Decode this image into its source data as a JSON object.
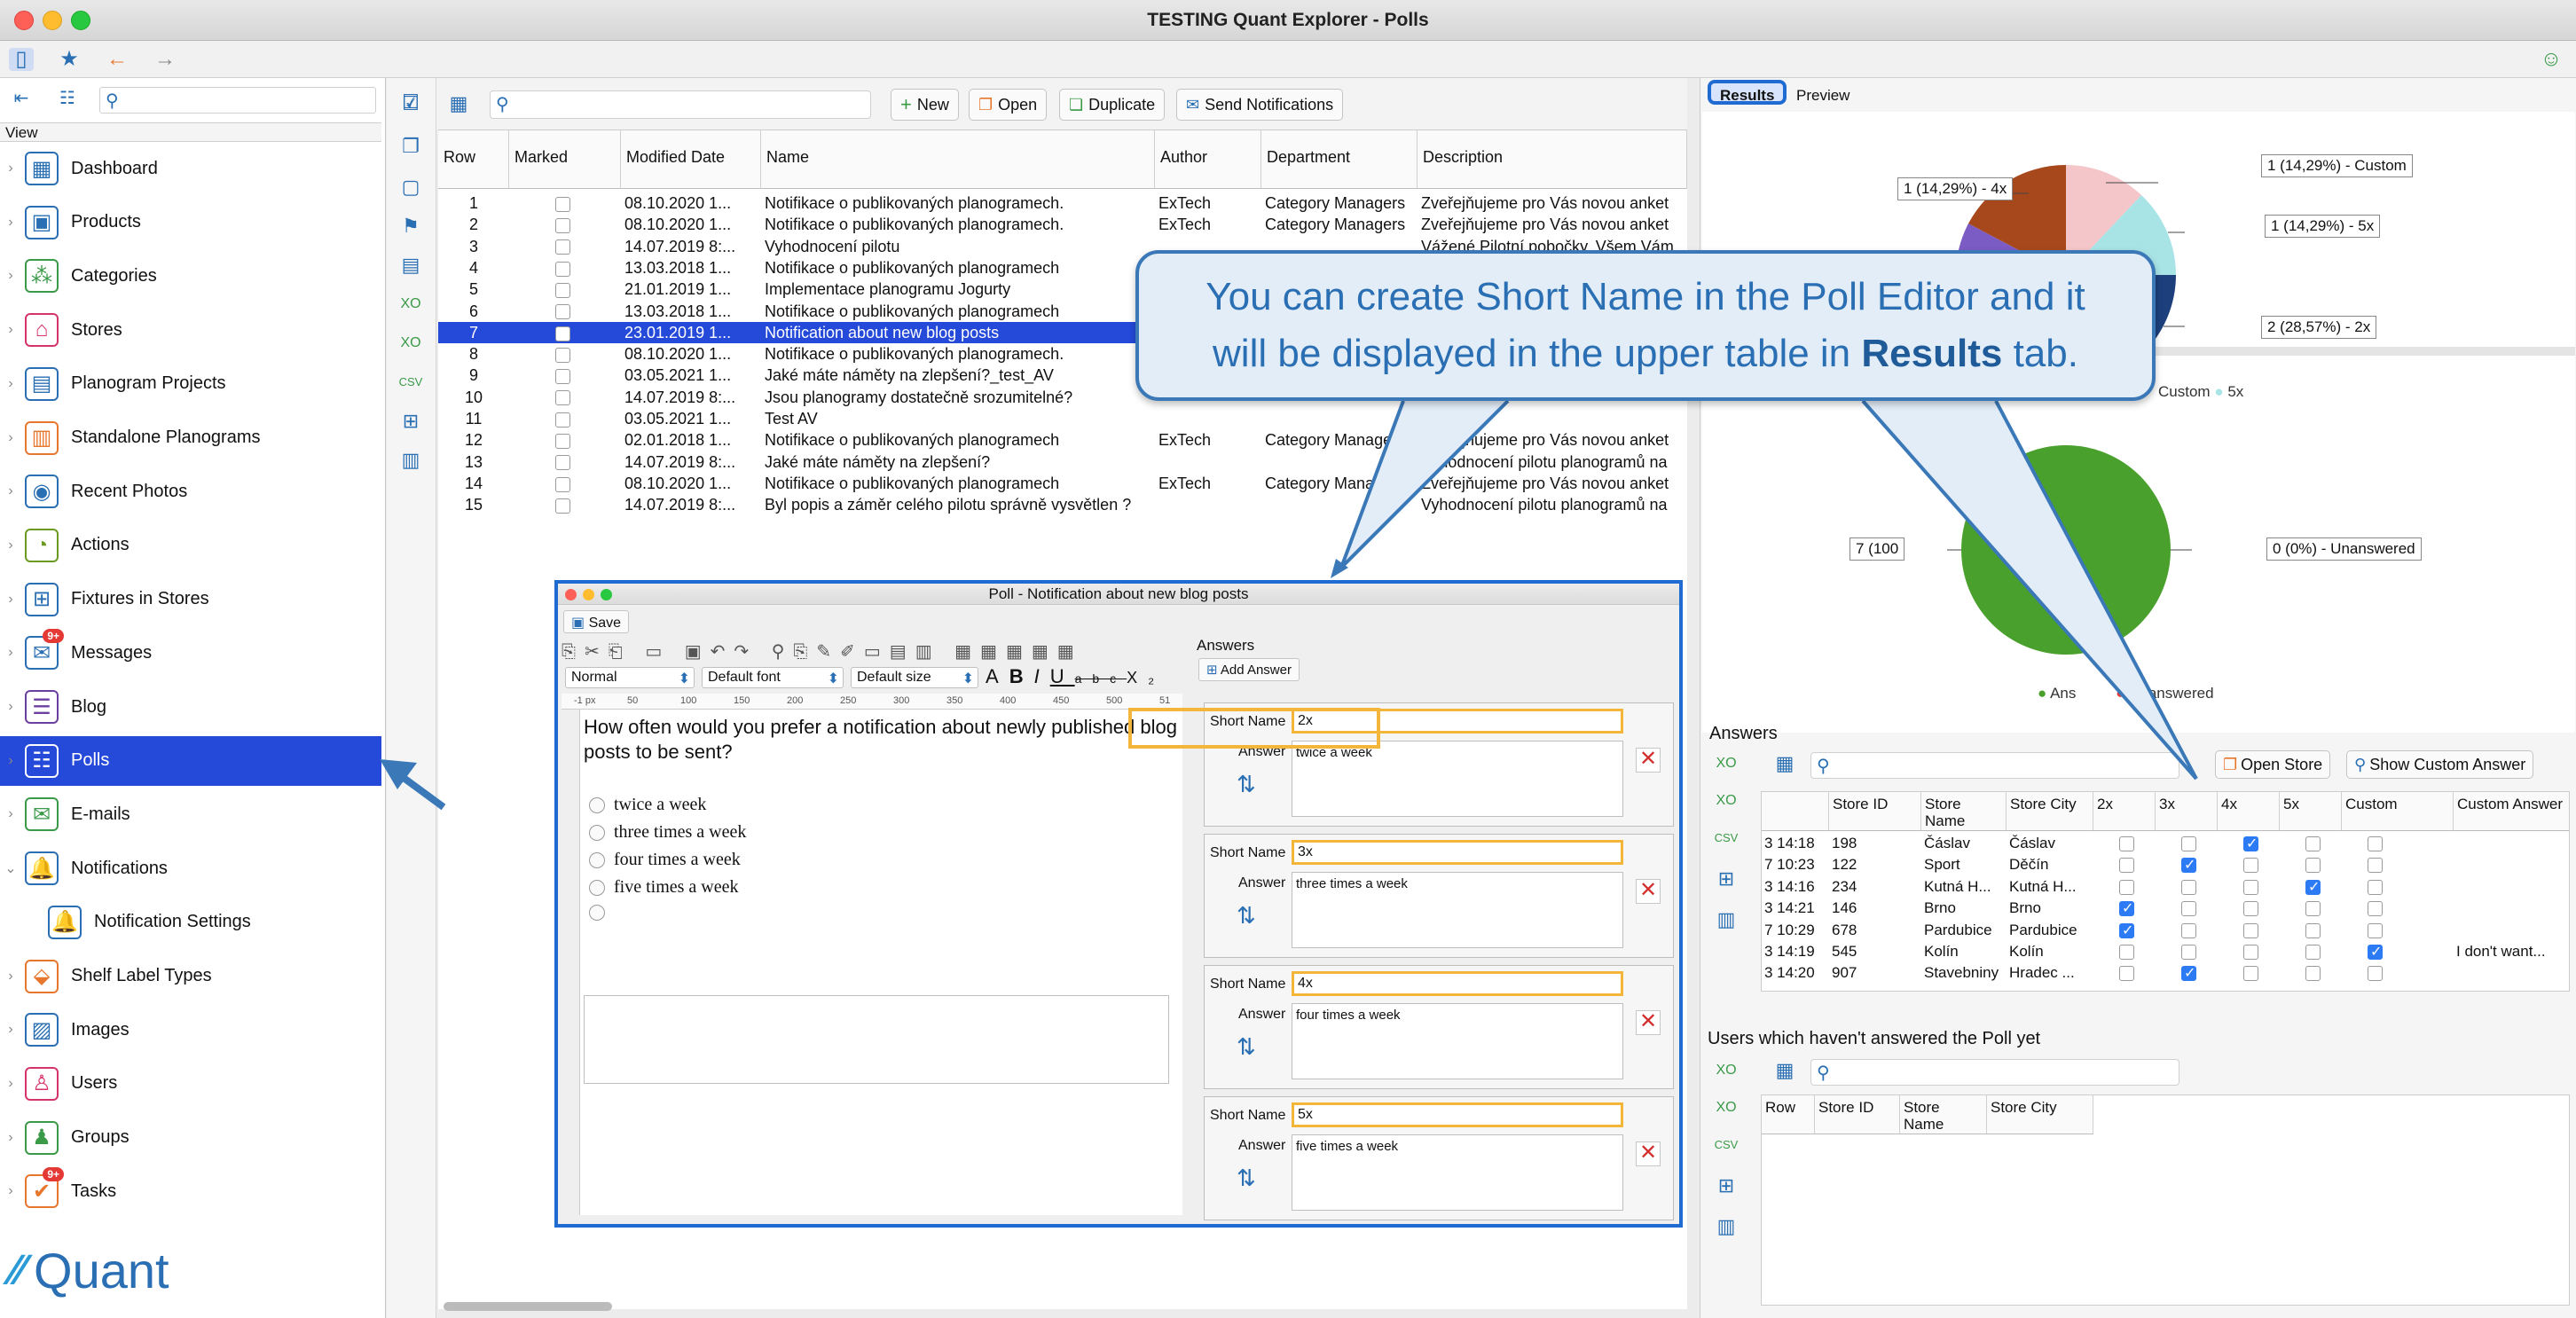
{
  "window": {
    "title": "TESTING Quant Explorer - Polls"
  },
  "sidebar": {
    "view_label": "View",
    "items": [
      {
        "label": "Dashboard",
        "icon": "dashboard-icon",
        "glyph": "▦",
        "color": "#2a6fb3"
      },
      {
        "label": "Products",
        "icon": "products-icon",
        "glyph": "▣",
        "color": "#2a6fb3"
      },
      {
        "label": "Categories",
        "icon": "categories-icon",
        "glyph": "⁂",
        "color": "#3a9a48"
      },
      {
        "label": "Stores",
        "icon": "stores-icon",
        "glyph": "⌂",
        "color": "#d6336c"
      },
      {
        "label": "Planogram Projects",
        "icon": "planogram-projects-icon",
        "glyph": "▤",
        "color": "#2a6fb3"
      },
      {
        "label": "Standalone Planograms",
        "icon": "standalone-planograms-icon",
        "glyph": "▥",
        "color": "#e8772e"
      },
      {
        "label": "Recent Photos",
        "icon": "camera-icon",
        "glyph": "◉",
        "color": "#2a6fb3"
      },
      {
        "label": "Actions",
        "icon": "actions-icon",
        "glyph": "◔",
        "color": "#6a9a20"
      },
      {
        "label": "Fixtures in Stores",
        "icon": "fixtures-icon",
        "glyph": "⊞",
        "color": "#2a6fb3"
      },
      {
        "label": "Messages",
        "icon": "messages-icon",
        "glyph": "✉",
        "color": "#2a6fb3",
        "badge": "9+"
      },
      {
        "label": "Blog",
        "icon": "blog-icon",
        "glyph": "☰",
        "color": "#6b3fa0"
      },
      {
        "label": "Polls",
        "icon": "polls-icon",
        "glyph": "☷",
        "color": "#d6336c"
      },
      {
        "label": "E-mails",
        "icon": "email-icon",
        "glyph": "✉",
        "color": "#3a9a48"
      },
      {
        "label": "Notifications",
        "icon": "notifications-icon",
        "glyph": "🔔",
        "color": "#2a6fb3"
      },
      {
        "label": "Notification Settings",
        "icon": "notification-settings-icon",
        "glyph": "🔔",
        "color": "#2a6fb3"
      },
      {
        "label": "Shelf Label Types",
        "icon": "shelf-label-icon",
        "glyph": "⬙",
        "color": "#e8772e"
      },
      {
        "label": "Images",
        "icon": "images-icon",
        "glyph": "▨",
        "color": "#2a6fb3"
      },
      {
        "label": "Users",
        "icon": "users-icon",
        "glyph": "♙",
        "color": "#d6336c"
      },
      {
        "label": "Groups",
        "icon": "groups-icon",
        "glyph": "♟",
        "color": "#3a9a48"
      },
      {
        "label": "Tasks",
        "icon": "tasks-icon",
        "glyph": "✔",
        "color": "#e8772e",
        "badge": "9+"
      }
    ],
    "logo_text": "Quant"
  },
  "toolbar": {
    "new_label": "New",
    "open_label": "Open",
    "duplicate_label": "Duplicate",
    "send_label": "Send Notifications"
  },
  "polls_table": {
    "columns": [
      "Row",
      "Marked",
      "Modified Date",
      "Name",
      "Author",
      "Department",
      "Description"
    ],
    "rows": [
      [
        "1",
        "",
        "08.10.2020 1...",
        "Notifikace o publikovaných planogramech.",
        "ExTech",
        "Category Managers",
        "Zveřejňujeme pro Vás novou anket"
      ],
      [
        "2",
        "",
        "08.10.2020 1...",
        "Notifikace o publikovaných planogramech.",
        "ExTech",
        "Category Managers",
        "Zveřejňujeme pro Vás novou anket"
      ],
      [
        "3",
        "",
        "14.07.2019 8:...",
        "Vyhodnocení pilotu",
        "",
        "",
        "Vážené Pilotní pobočky. Všem Vám"
      ],
      [
        "4",
        "",
        "13.03.2018 1...",
        "Notifikace o publikovaných planogramech",
        "",
        "",
        ""
      ],
      [
        "5",
        "",
        "21.01.2019 1...",
        "Implementace planogramu Jogurty",
        "",
        "",
        ""
      ],
      [
        "6",
        "",
        "13.03.2018 1...",
        "Notifikace o publikovaných planogramech",
        "",
        "",
        ""
      ],
      [
        "7",
        "",
        "23.01.2019 1...",
        "Notification about new blog posts",
        "",
        "",
        ""
      ],
      [
        "8",
        "",
        "08.10.2020 1...",
        "Notifikace o publikovaných planogramech.",
        "",
        "",
        ""
      ],
      [
        "9",
        "",
        "03.05.2021 1...",
        "Jaké máte náměty na zlepšení?_test_AV",
        "",
        "",
        ""
      ],
      [
        "10",
        "",
        "14.07.2019 8:...",
        "Jsou planogramy dostatečně srozumitelné?",
        "",
        "",
        ""
      ],
      [
        "11",
        "",
        "03.05.2021 1...",
        "Test AV",
        "",
        "",
        ""
      ],
      [
        "12",
        "",
        "02.01.2018 1...",
        "Notifikace o publikovaných planogramech",
        "ExTech",
        "Category Managers",
        "Zveřejňujeme pro Vás novou anket"
      ],
      [
        "13",
        "",
        "14.07.2019 8:...",
        "Jaké máte náměty na zlepšení?",
        "",
        "",
        "Vyhodnocení pilotu planogramů na"
      ],
      [
        "14",
        "",
        "08.10.2020 1...",
        "Notifikace o publikovaných planogramech",
        "ExTech",
        "Category Managers",
        "Zveřejňujeme pro Vás novou anket"
      ],
      [
        "15",
        "",
        "14.07.2019 8:...",
        "Byl popis a záměr celého pilotu správně vysvětlen ?",
        "",
        "",
        "Vyhodnocení pilotu planogramů na"
      ]
    ],
    "selected_row": 7
  },
  "poll_editor": {
    "title": "Poll - Notification about new blog posts",
    "save_label": "Save",
    "style_select": "Normal",
    "font_select": "Default font",
    "size_select": "Default size",
    "ruler_marks": [
      "-1 px",
      "50",
      "100",
      "150",
      "200",
      "250",
      "300",
      "350",
      "400",
      "450",
      "500",
      "51"
    ],
    "question": "How often would you prefer a notification about newly published blog posts to be sent?",
    "options": [
      "twice a week",
      "three times a week",
      "four times a week",
      "five times a week"
    ],
    "answers_title": "Answers",
    "add_answer_label": "Add Answer",
    "short_name_label": "Short Name",
    "answer_label": "Answer",
    "answers": [
      {
        "short_name": "2x",
        "answer": "twice a week"
      },
      {
        "short_name": "3x",
        "answer": "three times a week"
      },
      {
        "short_name": "4x",
        "answer": "four times a week"
      },
      {
        "short_name": "5x",
        "answer": "five times a week"
      }
    ]
  },
  "right_panel": {
    "tabs": [
      "Results",
      "Preview"
    ],
    "pie1_labels": [
      "1 (14,29%) - Custom",
      "1 (14,29%) - 4x",
      "1 (14,29%) - 5x",
      "2 (28,57%) - 2x"
    ],
    "pie1_legend": [
      "Custom",
      "5x"
    ],
    "pie2_labels": [
      "0 (0%) - Unanswered",
      "7 (100"
    ],
    "pie2_legend": [
      "Ans",
      "Unanswered"
    ],
    "answers_title": "Answers",
    "open_store_label": "Open Store",
    "show_custom_label": "Show Custom Answer",
    "answers_columns": [
      "",
      "Store ID",
      "Store Name",
      "Store City",
      "2x",
      "3x",
      "4x",
      "5x",
      "Custom",
      "Custom Answer"
    ],
    "answers_rows": [
      {
        "time": "3 14:18",
        "id": "198",
        "name": "Čáslav",
        "city": "Čáslav",
        "c": [
          0,
          0,
          1,
          0,
          0
        ],
        "custom": ""
      },
      {
        "time": "7 10:23",
        "id": "122",
        "name": "Sport",
        "city": "Děčín",
        "c": [
          0,
          1,
          0,
          0,
          0
        ],
        "custom": ""
      },
      {
        "time": "3 14:16",
        "id": "234",
        "name": "Kutná H...",
        "city": "Kutná H...",
        "c": [
          0,
          0,
          0,
          1,
          0
        ],
        "custom": ""
      },
      {
        "time": "3 14:21",
        "id": "146",
        "name": "Brno",
        "city": "Brno",
        "c": [
          1,
          0,
          0,
          0,
          0
        ],
        "custom": ""
      },
      {
        "time": "7 10:29",
        "id": "678",
        "name": "Pardubice",
        "city": "Pardubice",
        "c": [
          1,
          0,
          0,
          0,
          0
        ],
        "custom": ""
      },
      {
        "time": "3 14:19",
        "id": "545",
        "name": "Kolín",
        "city": "Kolín",
        "c": [
          0,
          0,
          0,
          0,
          1
        ],
        "custom": "I don't want..."
      },
      {
        "time": "3 14:20",
        "id": "907",
        "name": "Stavebniny",
        "city": "Hradec ...",
        "c": [
          0,
          1,
          0,
          0,
          0
        ],
        "custom": ""
      }
    ],
    "users_title": "Users which haven't answered the Poll yet",
    "users_columns": [
      "Row",
      "Store ID",
      "Store Name",
      "Store City"
    ]
  },
  "callout": {
    "text_before": "You can create Short Name in the Poll Editor and it will be displayed in the upper table in ",
    "bold": "Results",
    "text_after": " tab."
  },
  "colors": {
    "accent": "#2549d8",
    "highlight": "#f3b63b",
    "callout_border": "#3a78b8"
  }
}
